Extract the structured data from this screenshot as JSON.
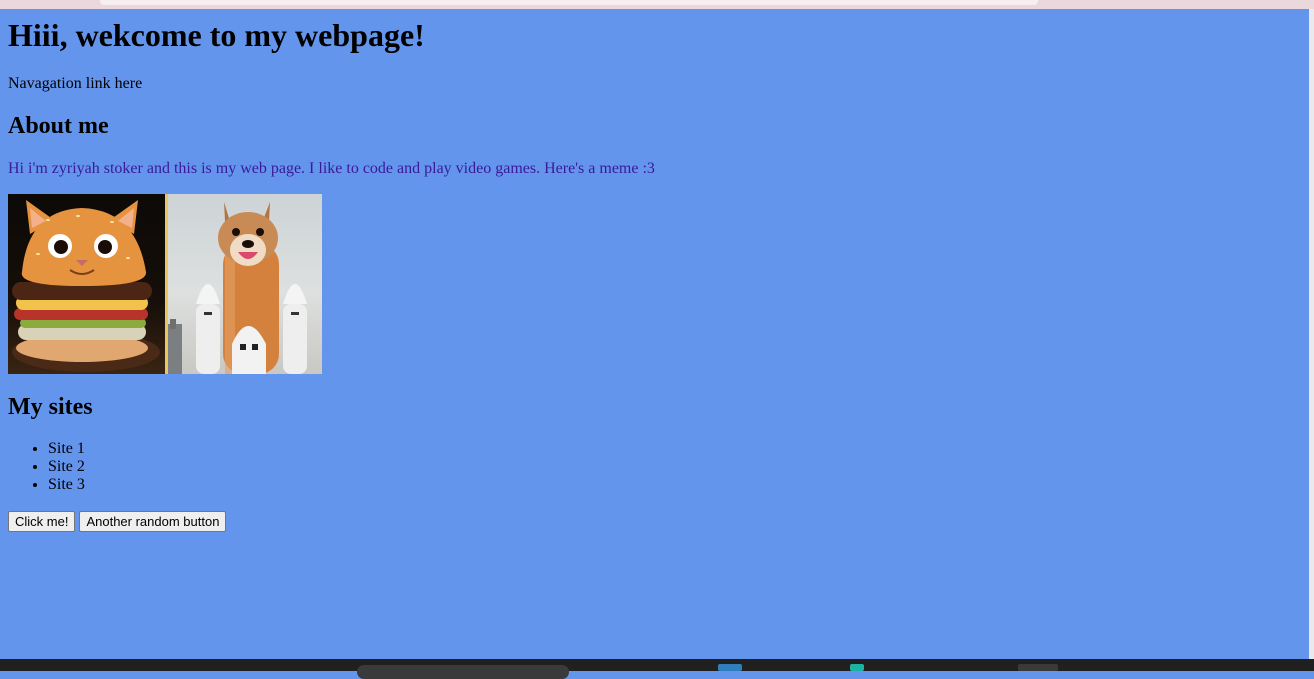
{
  "page": {
    "heading": "Hiii, wekcome to my webpage!",
    "nav_text": "Navagation link here",
    "about_title": "About me",
    "about_text": "Hi i'm zyriyah stoker and this is my web page. I like to code and play video games. Here's a meme :3",
    "meme": {
      "left_icon": "cat-burger-image",
      "right_icon": "dog-rocket-image"
    },
    "sites_title": "My sites",
    "sites": [
      "Site 1",
      "Site 2",
      "Site 3"
    ],
    "buttons": {
      "primary": "Click me!",
      "secondary": "Another random button"
    }
  },
  "colors": {
    "background": "#6495ed",
    "about_text": "#3a1a9a"
  }
}
